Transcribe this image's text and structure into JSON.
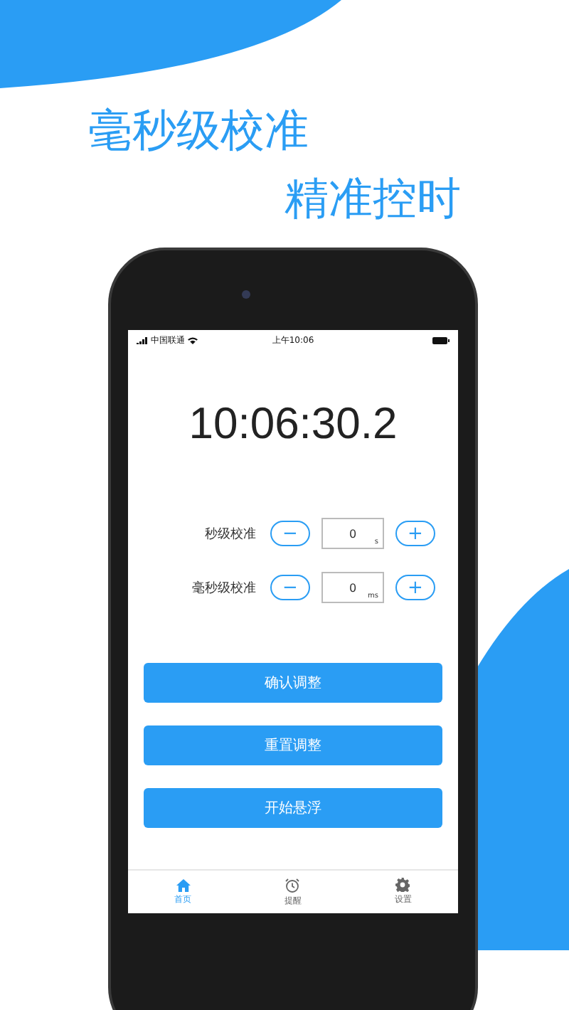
{
  "headline": [
    "毫秒级校准",
    "精准控时"
  ],
  "status_bar": {
    "carrier": "中国联通",
    "time": "上午10:06"
  },
  "clock": "10:06:30.2",
  "adjusters": [
    {
      "label": "秒级校准",
      "minus": "−",
      "value": "0",
      "unit": "s",
      "plus": "+"
    },
    {
      "label": "毫秒级校准",
      "minus": "−",
      "value": "0",
      "unit": "ms",
      "plus": "+"
    }
  ],
  "buttons": [
    "确认调整",
    "重置调整",
    "开始悬浮"
  ],
  "tabs": [
    {
      "label": "首页",
      "kind": "home",
      "selected": true
    },
    {
      "label": "提醒",
      "kind": "alarm",
      "selected": false
    },
    {
      "label": "设置",
      "kind": "gear",
      "selected": false
    }
  ]
}
